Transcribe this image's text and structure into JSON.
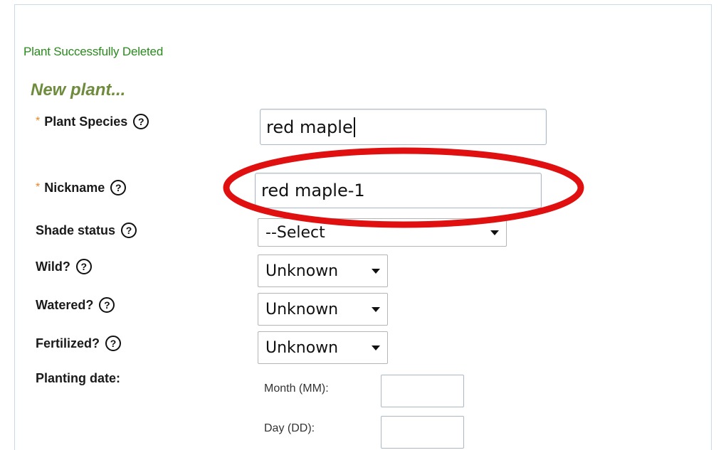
{
  "status_message": "Plant Successfully Deleted",
  "section_title": "New plant...",
  "required_marker": "*",
  "help_glyph": "?",
  "fields": {
    "species": {
      "label": "Plant Species",
      "value": "red maple"
    },
    "nickname": {
      "label": "Nickname",
      "value": "red maple-1"
    },
    "shade": {
      "label": "Shade status",
      "selected": "--Select"
    },
    "wild": {
      "label": "Wild?",
      "selected": "Unknown"
    },
    "watered": {
      "label": "Watered?",
      "selected": "Unknown"
    },
    "fertilized": {
      "label": "Fertilized?",
      "selected": "Unknown"
    },
    "planting_date": {
      "label": "Planting date:",
      "month_label": "Month (MM):",
      "day_label": "Day (DD):",
      "month_value": "",
      "day_value": ""
    }
  },
  "colors": {
    "status_green": "#2a8a1e",
    "title_olive": "#6f8c3e",
    "required_orange": "#e8862a",
    "annotation_red": "#e01010"
  },
  "icons": {
    "help": "help-circle-icon",
    "dropdown": "chevron-down-icon"
  }
}
